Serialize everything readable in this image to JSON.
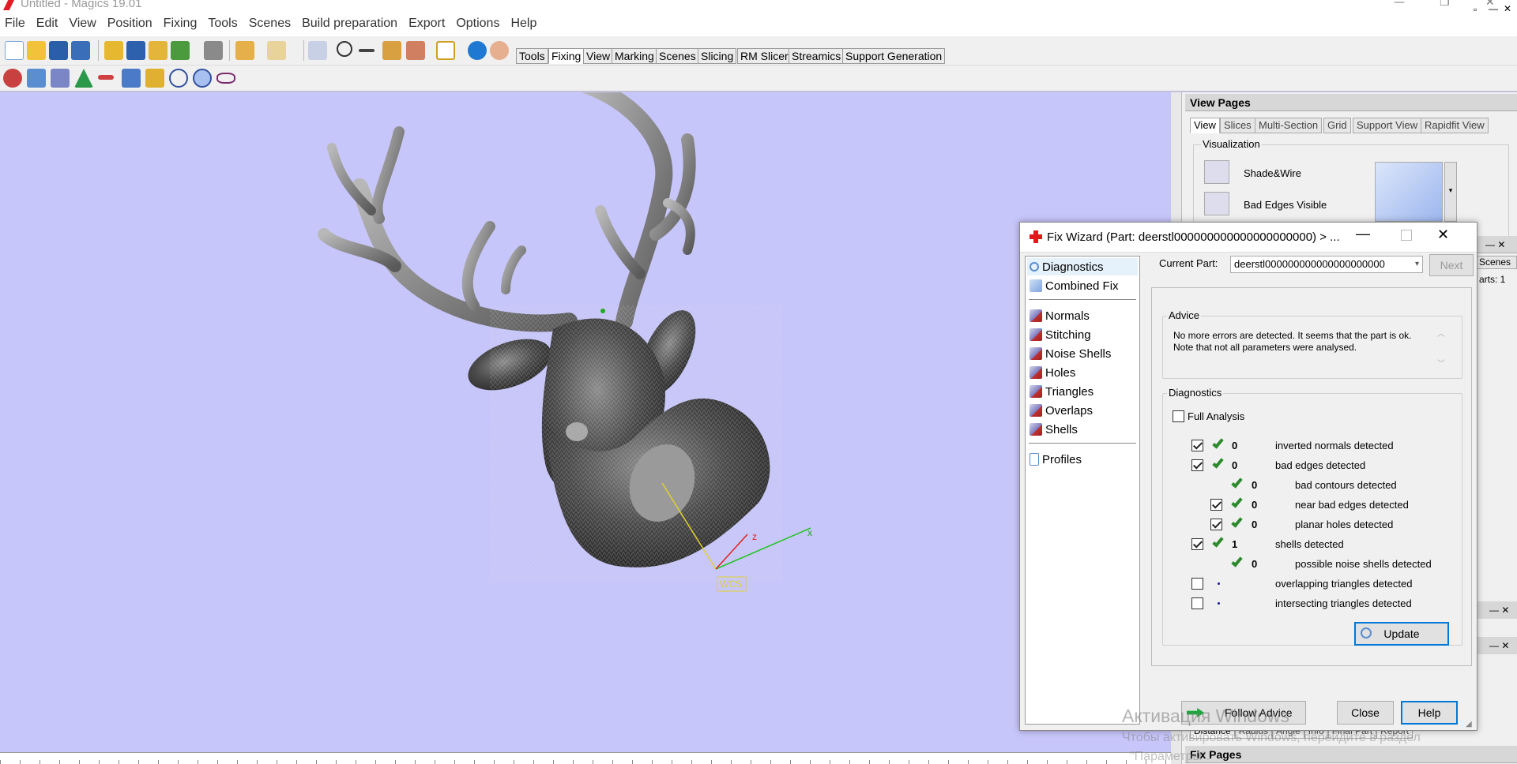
{
  "window": {
    "title": "Untitled - Magics 19.01"
  },
  "menu": [
    "File",
    "Edit",
    "View",
    "Position",
    "Fixing",
    "Tools",
    "Scenes",
    "Build preparation",
    "Export",
    "Options",
    "Help"
  ],
  "page_tabs": [
    {
      "label": "Tools",
      "active": false
    },
    {
      "label": "Fixing",
      "active": true
    },
    {
      "label": "View",
      "active": false
    },
    {
      "label": "Marking",
      "active": false
    },
    {
      "label": "Scenes",
      "active": false
    },
    {
      "label": "Slicing",
      "active": false
    },
    {
      "label": "RM Slicer",
      "active": false
    },
    {
      "label": "Streamics",
      "active": false
    },
    {
      "label": "Support Generation",
      "active": false
    }
  ],
  "viewport": {
    "wcs_label": "WCS",
    "axis_x": "x",
    "axis_z": "z",
    "background": "#c7c6fa"
  },
  "view_pages": {
    "title": "View Pages",
    "tabs": [
      "View",
      "Slices",
      "Multi-Section",
      "Grid",
      "Support View",
      "Rapidfit View"
    ],
    "visualization_label": "Visualization",
    "shade_wire": "Shade&Wire",
    "bad_edges": "Bad Edges Visible"
  },
  "side_fragments": {
    "scenes_tab": "Scenes",
    "parts_label": "arts: 1"
  },
  "bottom_tabs": [
    "Distance",
    "Radius",
    "Angle",
    "Info",
    "Final Part",
    "Report"
  ],
  "fix_pages_title": "Fix Pages",
  "fix_wizard": {
    "title": "Fix Wizard (Part: deerstl000000000000000000000) > ...",
    "nav": {
      "top": [
        "Diagnostics",
        "Combined Fix"
      ],
      "middle": [
        "Normals",
        "Stitching",
        "Noise Shells",
        "Holes",
        "Triangles",
        "Overlaps",
        "Shells"
      ],
      "bottom": [
        "Profiles"
      ]
    },
    "current_part_label": "Current Part:",
    "current_part_value": "deerstl000000000000000000000",
    "next_button": "Next",
    "advice_label": "Advice",
    "advice_text": "No more errors are detected. It seems that the part is ok. Note that not all parameters were analysed.",
    "diagnostics_label": "Diagnostics",
    "full_analysis": "Full Analysis",
    "rows": [
      {
        "checkbox": true,
        "checked": true,
        "status": "ok",
        "count": "0",
        "label": "inverted normals detected",
        "indent": 0
      },
      {
        "checkbox": true,
        "checked": true,
        "status": "ok",
        "count": "0",
        "label": "bad edges detected",
        "indent": 0
      },
      {
        "checkbox": false,
        "checked": false,
        "status": "ok",
        "count": "0",
        "label": "bad contours detected",
        "indent": 1
      },
      {
        "checkbox": true,
        "checked": true,
        "status": "ok",
        "count": "0",
        "label": "near bad edges detected",
        "indent": 1
      },
      {
        "checkbox": true,
        "checked": true,
        "status": "ok",
        "count": "0",
        "label": "planar holes detected",
        "indent": 1
      },
      {
        "checkbox": true,
        "checked": true,
        "status": "ok",
        "count": "1",
        "label": "shells detected",
        "indent": 0
      },
      {
        "checkbox": false,
        "checked": false,
        "status": "ok",
        "count": "0",
        "label": "possible noise shells detected",
        "indent": 1
      },
      {
        "checkbox": true,
        "checked": false,
        "status": "unknown",
        "count": "",
        "label": "overlapping triangles detected",
        "indent": 0
      },
      {
        "checkbox": true,
        "checked": false,
        "status": "unknown",
        "count": "",
        "label": "intersecting triangles detected",
        "indent": 0
      }
    ],
    "update_button": "Update",
    "follow_advice_button": "Follow Advice",
    "close_button": "Close",
    "help_button": "Help"
  },
  "watermark": {
    "line1": "Активация Windows",
    "line2": "Чтобы активировать Windows, перейдите в раздел",
    "line3": "\"Параметры\"."
  }
}
